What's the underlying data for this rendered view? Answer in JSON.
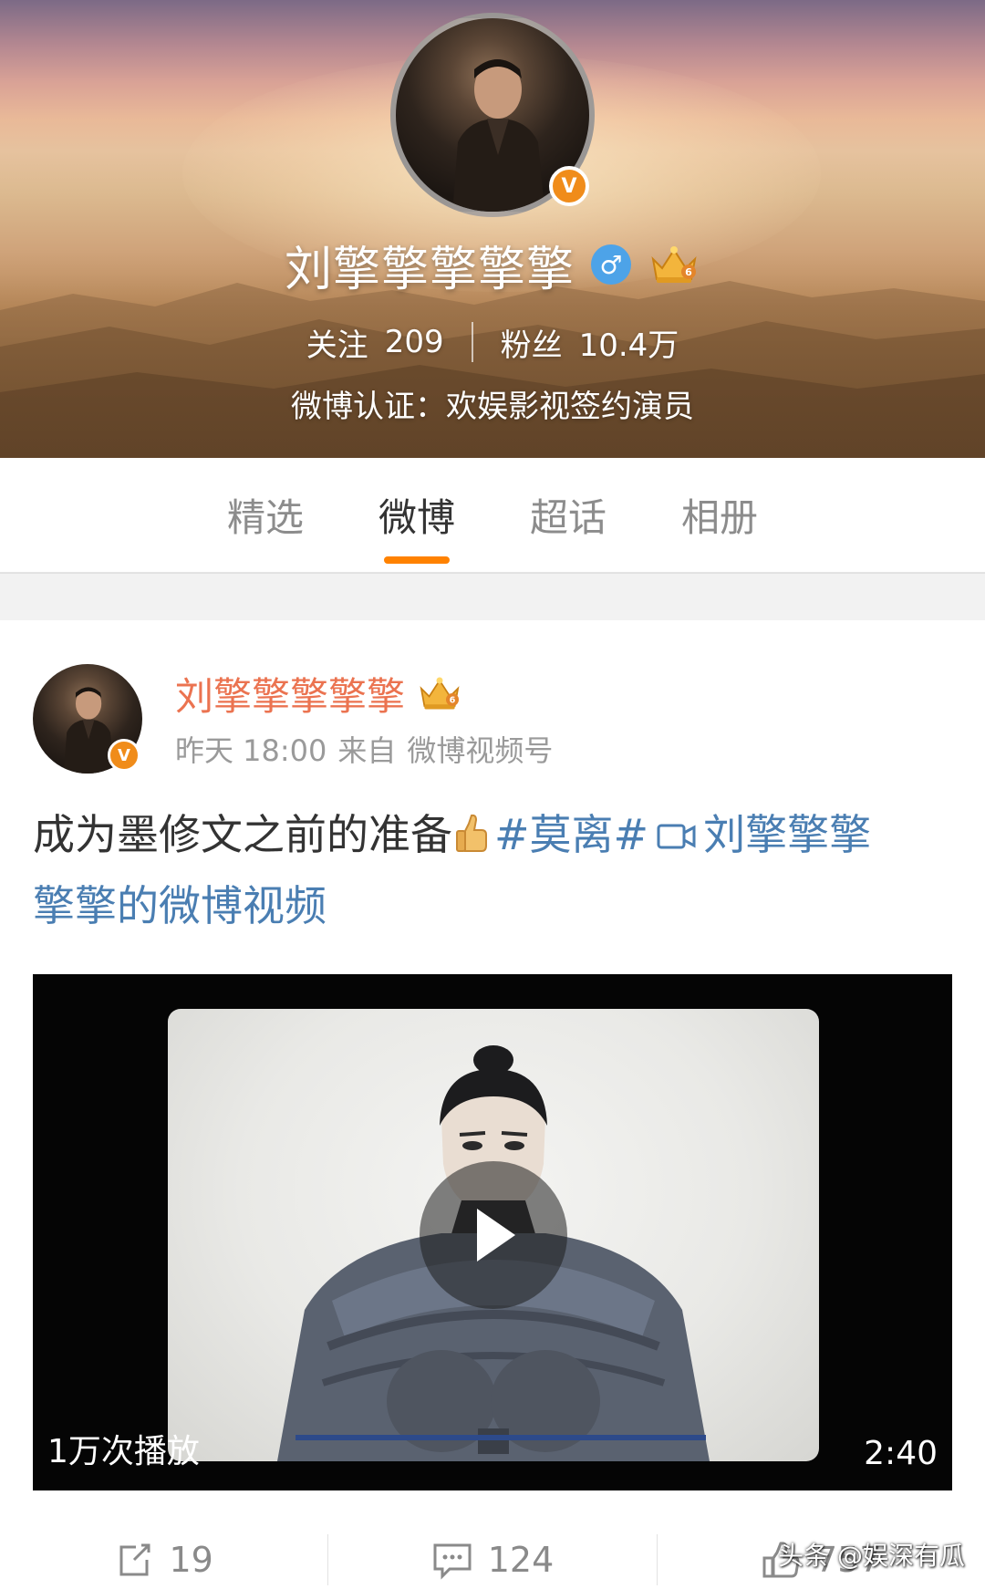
{
  "profile": {
    "name": "刘擎擎擎擎擎",
    "gender_icon": "♂",
    "verified_badge": "V",
    "following_label": "关注",
    "following_count": "209",
    "followers_label": "粉丝",
    "followers_count": "10.4万",
    "verification": "微博认证：欢娱影视签约演员"
  },
  "tabs": [
    {
      "label": "精选",
      "active": false
    },
    {
      "label": "微博",
      "active": true
    },
    {
      "label": "超话",
      "active": false
    },
    {
      "label": "相册",
      "active": false
    }
  ],
  "post": {
    "author": "刘擎擎擎擎擎",
    "verified_badge": "V",
    "time": "昨天 18:00",
    "source_prefix": "来自",
    "source": "微博视频号",
    "text_main": "成为墨修文之前的准备",
    "topic": "#莫离#",
    "video_link_part1": "刘擎擎擎",
    "video_link_part2": "擎擎的微博视频",
    "video": {
      "play_count": "1万次播放",
      "duration": "2:40"
    },
    "actions": {
      "reposts": "19",
      "comments": "124",
      "likes": "757"
    }
  },
  "watermark": "头条 @娱深有瓜",
  "colors": {
    "accent_orange": "#ff8200",
    "author_orange": "#eb7350",
    "link_blue": "#4a7eb2",
    "verified_orange": "#f08c1a",
    "gender_blue": "#4da3e8"
  },
  "icons": [
    "verified-v-icon",
    "male-gender-icon",
    "crown-level-icon",
    "thumbs-up-emoji",
    "video-link-icon",
    "play-icon",
    "repost-icon",
    "comment-icon",
    "like-icon"
  ]
}
